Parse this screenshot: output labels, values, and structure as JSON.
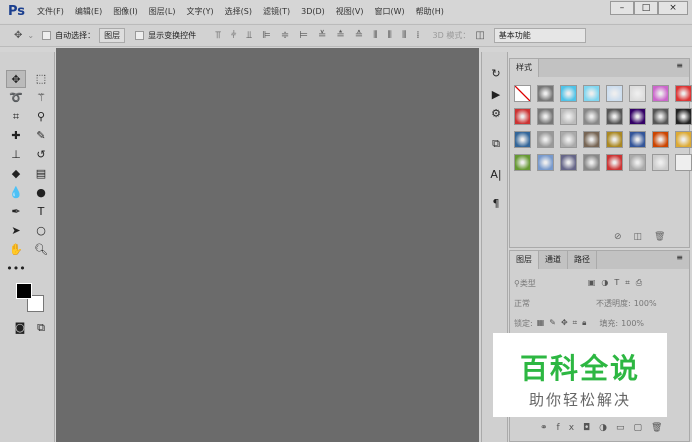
{
  "app": {
    "logo": "Ps"
  },
  "menu": [
    "文件(F)",
    "编辑(E)",
    "图像(I)",
    "图层(L)",
    "文字(Y)",
    "选择(S)",
    "滤镜(T)",
    "3D(D)",
    "视图(V)",
    "窗口(W)",
    "帮助(H)"
  ],
  "window": {
    "minimize": "–",
    "maximize": "□",
    "close": "×"
  },
  "options": {
    "auto_select": "自动选择：",
    "layer_select": "图层",
    "show_transform": "显示变换控件",
    "mode_3d": "3D 模式：",
    "workspace": "基本功能"
  },
  "styles_panel": {
    "tab": "样式",
    "swatch_colors": [
      "#fff",
      "#777",
      "#4fc3e8",
      "#7fd6f0",
      "#cde",
      "#ddd",
      "#c6c",
      "#d33",
      "#c33",
      "#777",
      "#bbb",
      "#888",
      "#555",
      "#306",
      "#555",
      "#222",
      "#369",
      "#999",
      "#aaa",
      "#765",
      "#a82",
      "#359",
      "#c40",
      "#da3",
      "#693",
      "#79c",
      "#668",
      "#888",
      "#c33",
      "#aaa",
      "#ccc",
      "#eee"
    ]
  },
  "layers_panel": {
    "tabs": [
      "图层",
      "通道",
      "路径"
    ],
    "filter": "类型",
    "blend": "正常",
    "opacity_label": "不透明度:",
    "opacity": "100%",
    "lock_label": "锁定:",
    "fill_label": "填充:",
    "fill": "100%"
  },
  "watermark": {
    "title": "百科全说",
    "subtitle": "助你轻松解决"
  }
}
